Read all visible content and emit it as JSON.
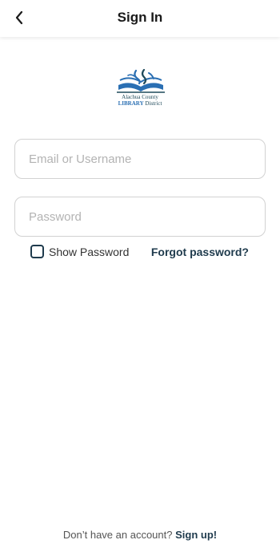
{
  "header": {
    "title": "Sign In",
    "back_icon": "chevron-left-icon"
  },
  "logo": {
    "line1": "Alachua County",
    "line2_accent": "LIBRARY",
    "line2_rest": " District",
    "accent_color": "#2a6fb3"
  },
  "form": {
    "email": {
      "placeholder": "Email or Username",
      "value": ""
    },
    "password": {
      "placeholder": "Password",
      "value": ""
    },
    "show_password_label": "Show Password",
    "show_password_checked": false,
    "forgot_label": "Forgot password?"
  },
  "footer": {
    "prompt": "Don’t have an account?",
    "signup_label": "Sign up!"
  },
  "colors": {
    "primary_dark": "#1f3b4d",
    "field_border": "#d2d2d2",
    "placeholder": "#b3b3b3"
  }
}
